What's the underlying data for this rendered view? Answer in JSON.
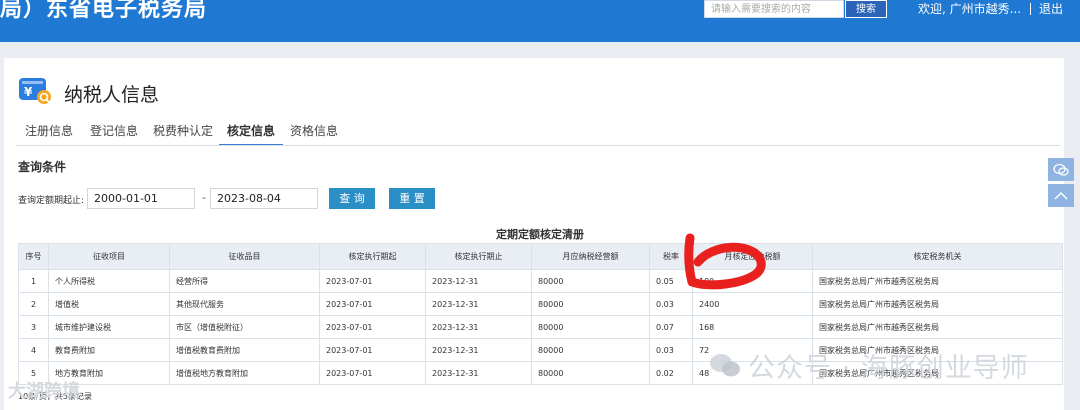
{
  "header": {
    "site_title": "局）东省电子税务局",
    "search_placeholder": "请输入需要搜索的内容",
    "search_button": "搜索",
    "welcome": "欢迎, 广州市越秀...",
    "logout": "退出",
    "accent_color": "#1f78d1"
  },
  "page": {
    "title": "纳税人信息",
    "icon": "tax-card-icon"
  },
  "tabs": [
    {
      "label": "注册信息",
      "active": false
    },
    {
      "label": "登记信息",
      "active": false
    },
    {
      "label": "税费种认定",
      "active": false
    },
    {
      "label": "核定信息",
      "active": true
    },
    {
      "label": "资格信息",
      "active": false
    }
  ],
  "query": {
    "section_title": "查询条件",
    "label": "查询定额期起止:",
    "start_date": "2000-01-01",
    "end_date": "2023-08-04",
    "separator": "-",
    "query_button": "查  询",
    "reset_button": "重  置"
  },
  "table": {
    "caption": "定期定额核定清册",
    "headers": [
      "序号",
      "征收项目",
      "征收品目",
      "核定执行期起",
      "核定执行期止",
      "月应纳税经营额",
      "税率",
      "月核定应纳税额",
      "核定税务机关"
    ],
    "rows": [
      [
        "1",
        "个人所得税",
        "经营所得",
        "2023-07-01",
        "2023-12-31",
        "80000",
        "0.05",
        "190",
        "国家税务总局广州市越秀区税务局"
      ],
      [
        "2",
        "增值税",
        "其他现代服务",
        "2023-07-01",
        "2023-12-31",
        "80000",
        "0.03",
        "2400",
        "国家税务总局广州市越秀区税务局"
      ],
      [
        "3",
        "城市维护建设税",
        "市区（增值税附征）",
        "2023-07-01",
        "2023-12-31",
        "80000",
        "0.07",
        "168",
        "国家税务总局广州市越秀区税务局"
      ],
      [
        "4",
        "教育费附加",
        "增值税教育费附加",
        "2023-07-01",
        "2023-12-31",
        "80000",
        "0.03",
        "72",
        "国家税务总局广州市越秀区税务局"
      ],
      [
        "5",
        "地方教育附加",
        "增值税地方教育附加",
        "2023-07-01",
        "2023-12-31",
        "80000",
        "0.02",
        "48",
        "国家税务总局广州市越秀区税务局"
      ]
    ],
    "pager": "10条/页，共5条记录"
  },
  "watermarks": {
    "right": "公众号 · 海豚创业导师",
    "left": "大湖跨境"
  },
  "colors": {
    "annotation_red": "#e8201e",
    "button_blue": "#2a8fc4",
    "tab_underline": "#3a7fd6"
  }
}
